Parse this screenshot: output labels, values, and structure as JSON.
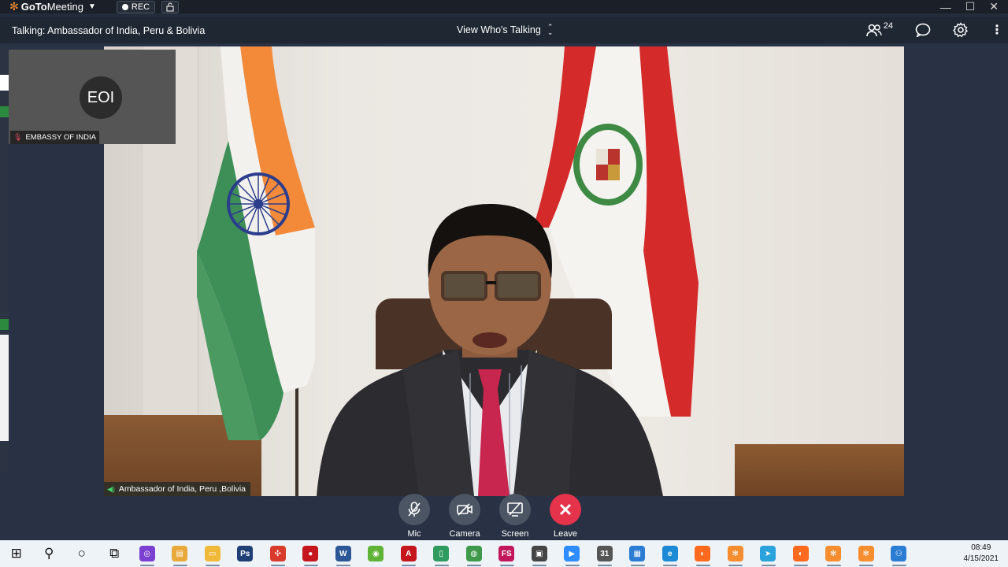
{
  "app": {
    "brand_goto": "GoTo",
    "brand_meeting": "Meeting",
    "rec_label": "REC"
  },
  "infobar": {
    "talking": "Talking: Ambassador of India, Peru & Bolivia",
    "view_mode": "View Who's Talking",
    "participant_count": "24"
  },
  "thumbnail": {
    "initials": "EOI",
    "name": "EMBASSY OF INDIA"
  },
  "main_video": {
    "speaker_name": "Ambassador of India, Peru ,Bolivia"
  },
  "controls": {
    "mic": "Mic",
    "camera": "Camera",
    "screen": "Screen",
    "leave": "Leave"
  },
  "taskbar": {
    "time": "08:49",
    "date": "4/15/2021",
    "apps": [
      {
        "name": "start",
        "glyph": "⊞",
        "color": "#111"
      },
      {
        "name": "search",
        "glyph": "⚲",
        "color": "#111"
      },
      {
        "name": "cortana",
        "glyph": "○",
        "color": "#111"
      },
      {
        "name": "task-view",
        "glyph": "⧉",
        "color": "#111"
      },
      {
        "name": "app-purple-ring",
        "glyph": "◎",
        "color": "#7b3fd1"
      },
      {
        "name": "app-folder-yellow",
        "glyph": "▤",
        "color": "#e8a93a"
      },
      {
        "name": "file-explorer",
        "glyph": "▭",
        "color": "#f0b93a"
      },
      {
        "name": "photoshop",
        "glyph": "Ps",
        "color": "#1f3f76"
      },
      {
        "name": "app-network",
        "glyph": "✣",
        "color": "#d83b2b"
      },
      {
        "name": "app-record",
        "glyph": "●",
        "color": "#c4161c"
      },
      {
        "name": "word",
        "glyph": "W",
        "color": "#2b5797"
      },
      {
        "name": "app-green-circle",
        "glyph": "◉",
        "color": "#5fb336"
      },
      {
        "name": "acrobat",
        "glyph": "A",
        "color": "#c4161c"
      },
      {
        "name": "app-phone",
        "glyph": "▯",
        "color": "#2f9b5e"
      },
      {
        "name": "chrome",
        "glyph": "◍",
        "color": "#3e9a4a"
      },
      {
        "name": "app-fs",
        "glyph": "FS",
        "color": "#c2185b"
      },
      {
        "name": "app-clapper",
        "glyph": "▣",
        "color": "#444"
      },
      {
        "name": "zoom",
        "glyph": "▶",
        "color": "#2d8cff"
      },
      {
        "name": "calendar",
        "glyph": "31",
        "color": "#555"
      },
      {
        "name": "app-tiles",
        "glyph": "▦",
        "color": "#2b7cd3"
      },
      {
        "name": "edge",
        "glyph": "e",
        "color": "#1c8ad6"
      },
      {
        "name": "firefox-1",
        "glyph": "◐",
        "color": "#ff6a1f"
      },
      {
        "name": "gotomeeting-1",
        "glyph": "✻",
        "color": "#f68d2e"
      },
      {
        "name": "telegram",
        "glyph": "➤",
        "color": "#2aa3dd"
      },
      {
        "name": "firefox-2",
        "glyph": "◐",
        "color": "#ff6a1f"
      },
      {
        "name": "gotomeeting-2",
        "glyph": "✻",
        "color": "#f68d2e"
      },
      {
        "name": "gotomeeting-3",
        "glyph": "✻",
        "color": "#f68d2e"
      },
      {
        "name": "people",
        "glyph": "⚇",
        "color": "#2b7cd3"
      }
    ]
  },
  "colors": {
    "accent_orange": "#f68d2e",
    "leave_red": "#e5334b",
    "control_gray": "#4b5563",
    "bar_dark": "#1f2733"
  }
}
